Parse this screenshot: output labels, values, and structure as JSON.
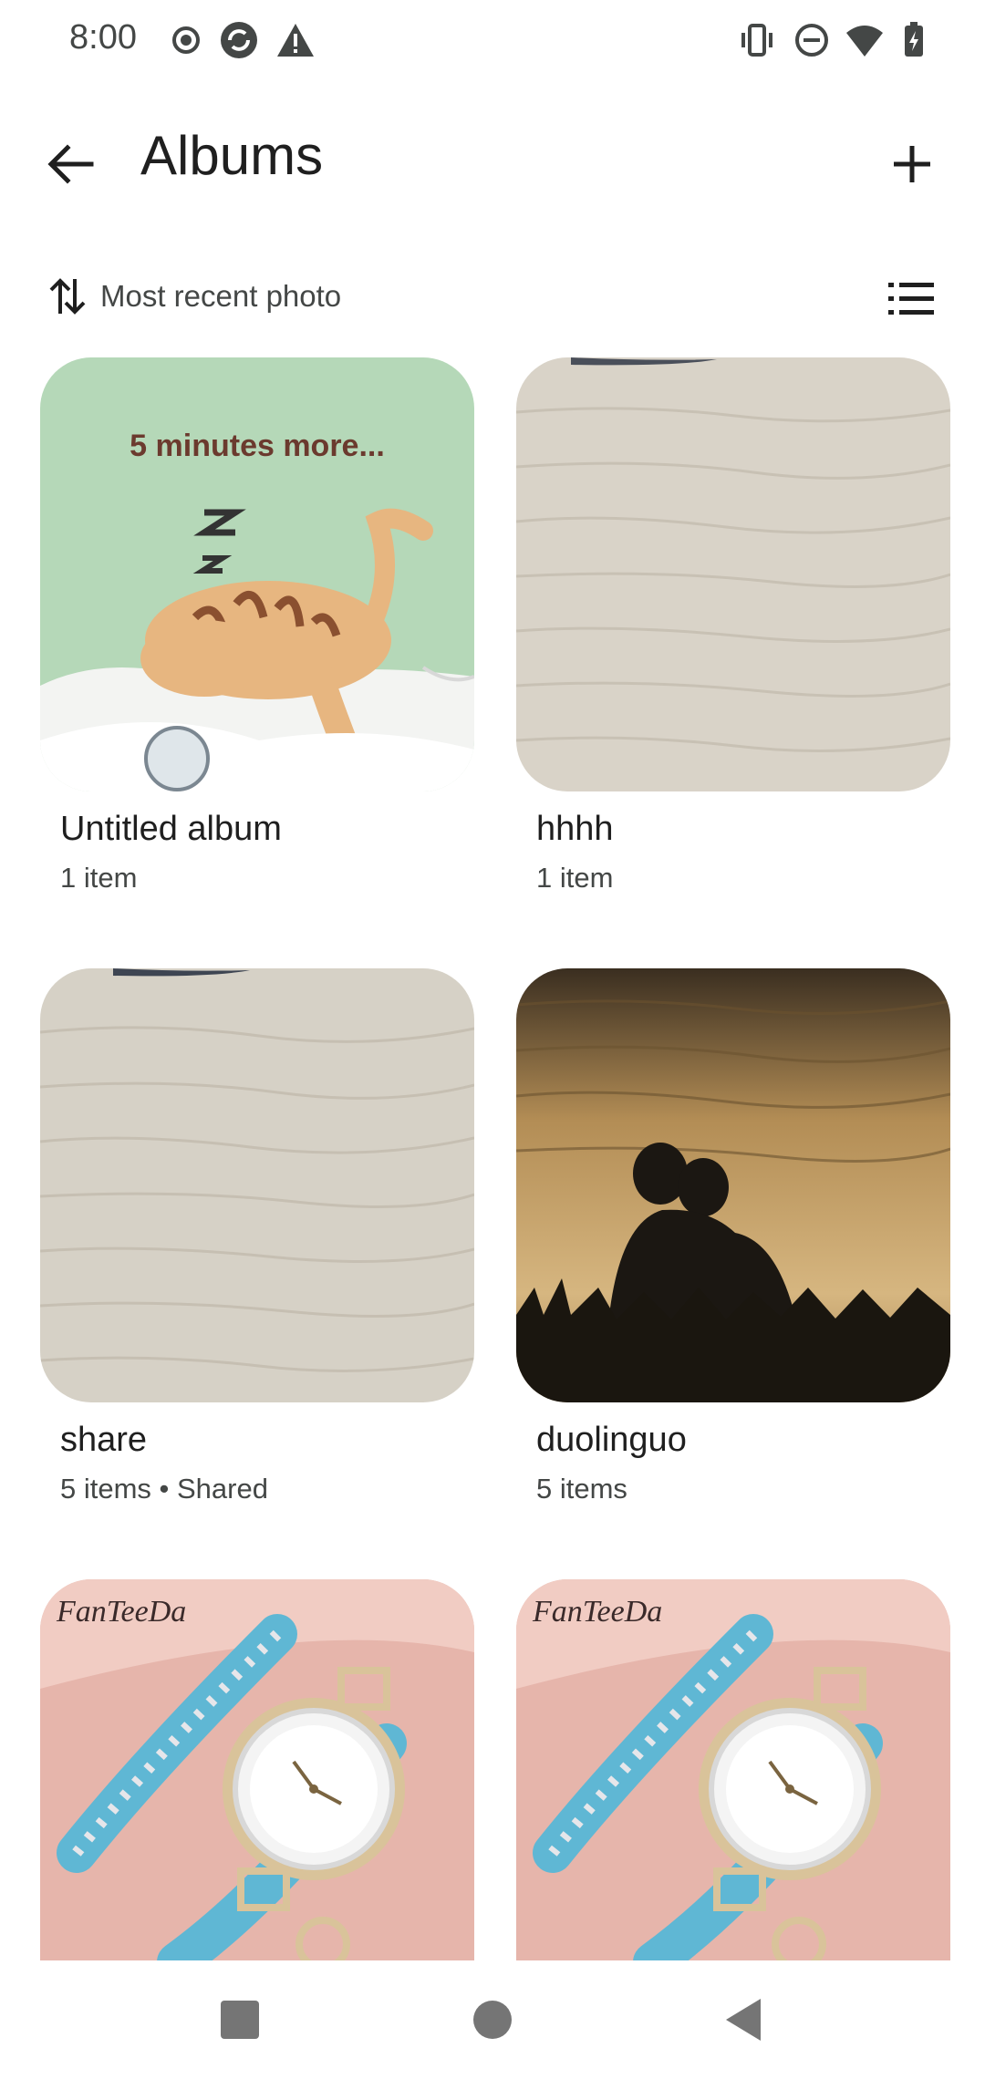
{
  "status_bar": {
    "time": "8:00",
    "left_icons": [
      "record-icon",
      "sync-icon",
      "warning-icon"
    ],
    "right_icons": [
      "vibrate-icon",
      "do-not-disturb-icon",
      "wifi-icon",
      "battery-charging-icon"
    ]
  },
  "app_bar": {
    "title": "Albums",
    "back_icon": "arrow-back-icon",
    "add_icon": "plus-icon"
  },
  "sort": {
    "label": "Most recent photo",
    "sort_icon": "swap-vertical-icon",
    "view_icon": "list-view-icon"
  },
  "albums": [
    {
      "name": "Untitled album",
      "meta": "1 item",
      "thumb_text": "5 minutes more..."
    },
    {
      "name": "hhhh",
      "meta": "1 item"
    },
    {
      "name": "share",
      "meta": "5 items • Shared"
    },
    {
      "name": "duolinguo",
      "meta": "5 items"
    },
    {
      "name": "",
      "meta": "",
      "thumb_text": "FanTeeDa"
    },
    {
      "name": "",
      "meta": "",
      "thumb_text": "FanTeeDa"
    }
  ],
  "nav_bar": {
    "buttons": [
      "recents-square-icon",
      "home-circle-icon",
      "back-triangle-icon"
    ]
  },
  "colors": {
    "text_primary": "#1f1f1f",
    "text_secondary": "#444746",
    "cat_bg": "#b5d8b8",
    "wood": "#d9d3c8",
    "sunset": "#c9a46a",
    "pink": "#e6b5ab",
    "watch_blue": "#5fb7d4"
  }
}
